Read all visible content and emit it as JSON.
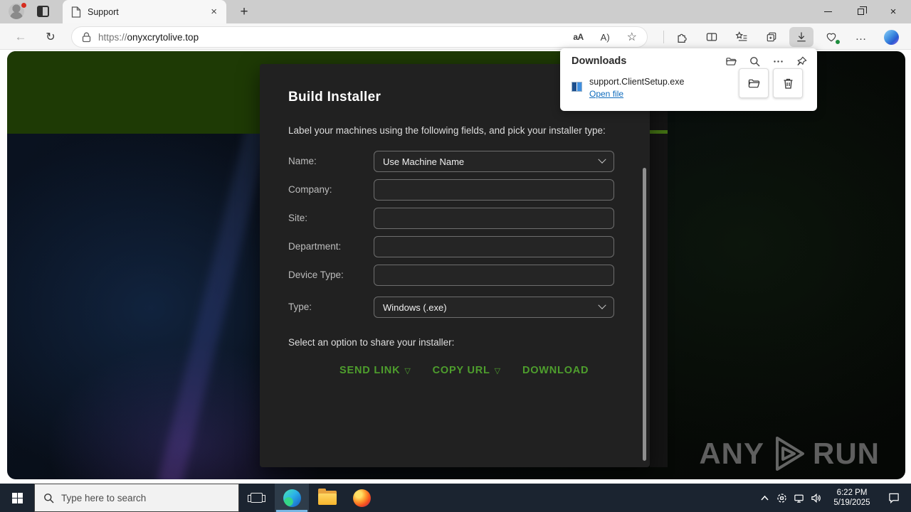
{
  "browser": {
    "tab_title": "Support",
    "url_scheme": "https://",
    "url_domain": "onyxcrytolive.top",
    "glyphs": {
      "close": "×",
      "new_tab": "+",
      "back": "←",
      "refresh": "↻",
      "translate": "aA",
      "read_aloud": "A)",
      "favorite_star": "☆",
      "more_dots": "…"
    }
  },
  "downloads": {
    "title": "Downloads",
    "file_name": "support.ClientSetup.exe",
    "open_file": "Open file"
  },
  "page": {
    "form": {
      "title": "Build Installer",
      "instructions": "Label your machines using the following fields, and pick your installer type:",
      "fields": [
        {
          "label": "Name:",
          "type": "select",
          "value": "Use Machine Name"
        },
        {
          "label": "Company:",
          "type": "text",
          "value": ""
        },
        {
          "label": "Site:",
          "type": "text",
          "value": ""
        },
        {
          "label": "Department:",
          "type": "text",
          "value": ""
        },
        {
          "label": "Device Type:",
          "type": "text",
          "value": ""
        },
        {
          "label": "Type:",
          "type": "select",
          "value": "Windows (.exe)"
        }
      ],
      "share_prompt": "Select an option to share your installer:",
      "actions": [
        {
          "label": "SEND LINK",
          "has_dropdown": true
        },
        {
          "label": "COPY URL",
          "has_dropdown": true
        },
        {
          "label": "DOWNLOAD",
          "has_dropdown": false
        }
      ],
      "dropdown_glyph": "▽"
    }
  },
  "watermark": {
    "left": "ANY",
    "right": "RUN"
  },
  "taskbar": {
    "search_placeholder": "Type here to search",
    "time": "6:22 PM",
    "date": "5/19/2025"
  },
  "colors": {
    "accent_green": "#4e9e2d",
    "band_green": "#1e3a05",
    "link_blue": "#0f6cbd"
  }
}
